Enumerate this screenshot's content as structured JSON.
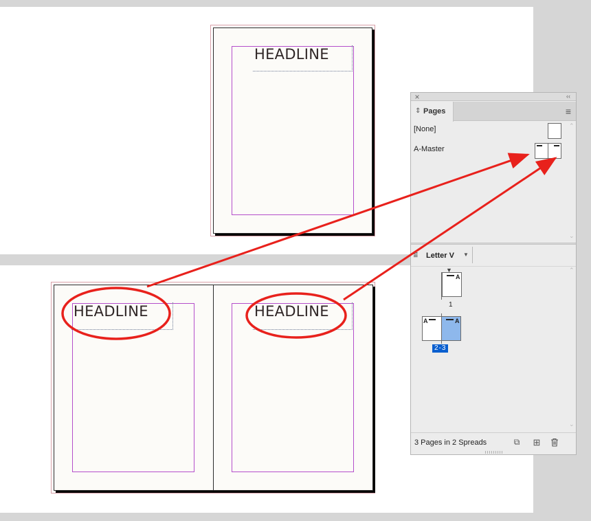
{
  "document": {
    "top_spread": {
      "headline": "HEADLINE"
    },
    "bottom_spread": {
      "left_headline": "HEADLINE",
      "right_headline": "HEADLINE"
    }
  },
  "pages_panel": {
    "close_icon": "×",
    "collapse_icon": "‹‹",
    "tab_label": "Pages",
    "tab_icon": "⌃⌄",
    "menu_icon": "≡",
    "masters": [
      {
        "label": "[None]"
      },
      {
        "label": "A-Master"
      }
    ],
    "page_size_label": "Letter V",
    "pages": [
      {
        "number": "1",
        "master_prefix": "A"
      },
      {
        "number": "2-3",
        "master_prefix": "A",
        "selected": true
      }
    ],
    "status": "3 Pages in 2 Spreads",
    "footer_icons": [
      "edit-page-size-icon",
      "new-page-icon",
      "trash-icon"
    ]
  },
  "colors": {
    "arrow": "#e8211c",
    "selection": "#0a5fcf",
    "selected_page": "#8eb8ec",
    "margin_guide": "#b44ecb"
  }
}
